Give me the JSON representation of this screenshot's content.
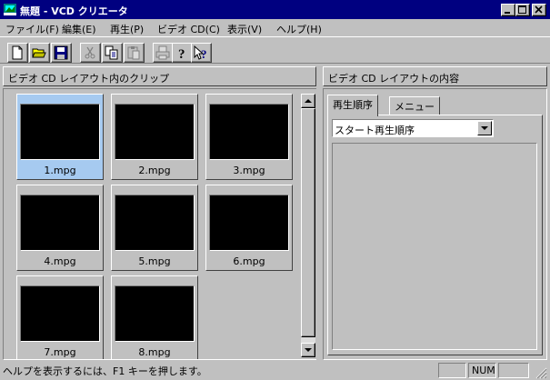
{
  "window": {
    "title": "無題 - VCD クリエータ",
    "controls": {
      "minimize": "minimize-icon",
      "maximize": "maximize-icon",
      "close": "close-icon"
    }
  },
  "menu": [
    {
      "label": "ファイル(F)"
    },
    {
      "label": "編集(E)"
    },
    {
      "label": "再生(P)"
    },
    {
      "label": "ビデオ CD(C)"
    },
    {
      "label": "表示(V)"
    },
    {
      "label": "ヘルプ(H)"
    }
  ],
  "toolbar": [
    {
      "icon": "new-document-icon",
      "enabled": true
    },
    {
      "icon": "open-folder-icon",
      "enabled": true
    },
    {
      "icon": "save-disk-icon",
      "enabled": true
    },
    {
      "icon": "cut-icon",
      "enabled": false
    },
    {
      "icon": "copy-icon",
      "enabled": true
    },
    {
      "icon": "paste-icon",
      "enabled": false
    },
    {
      "icon": "print-icon",
      "enabled": false
    },
    {
      "icon": "help-icon",
      "enabled": true
    },
    {
      "icon": "context-help-icon",
      "enabled": true
    }
  ],
  "left_pane": {
    "title": "ビデオ CD レイアウト内のクリップ",
    "clips": [
      {
        "name": "1.mpg",
        "selected": true
      },
      {
        "name": "2.mpg",
        "selected": false
      },
      {
        "name": "3.mpg",
        "selected": false
      },
      {
        "name": "4.mpg",
        "selected": false
      },
      {
        "name": "5.mpg",
        "selected": false
      },
      {
        "name": "6.mpg",
        "selected": false
      },
      {
        "name": "7.mpg",
        "selected": false
      },
      {
        "name": "8.mpg",
        "selected": false
      }
    ]
  },
  "right_pane": {
    "title": "ビデオ CD レイアウトの内容",
    "tabs": [
      {
        "label": "再生順序",
        "active": true
      },
      {
        "label": "メニュー",
        "active": false
      }
    ],
    "order_select": {
      "value": "スタート再生順序"
    }
  },
  "status": {
    "message": "ヘルプを表示するには、F1 キーを押します。",
    "panels": [
      "",
      "NUM",
      ""
    ]
  },
  "colors": {
    "titlebar": "#000080",
    "face": "#c0c0c0",
    "selection": "#a6caf0",
    "thumbnail": "#000000"
  }
}
